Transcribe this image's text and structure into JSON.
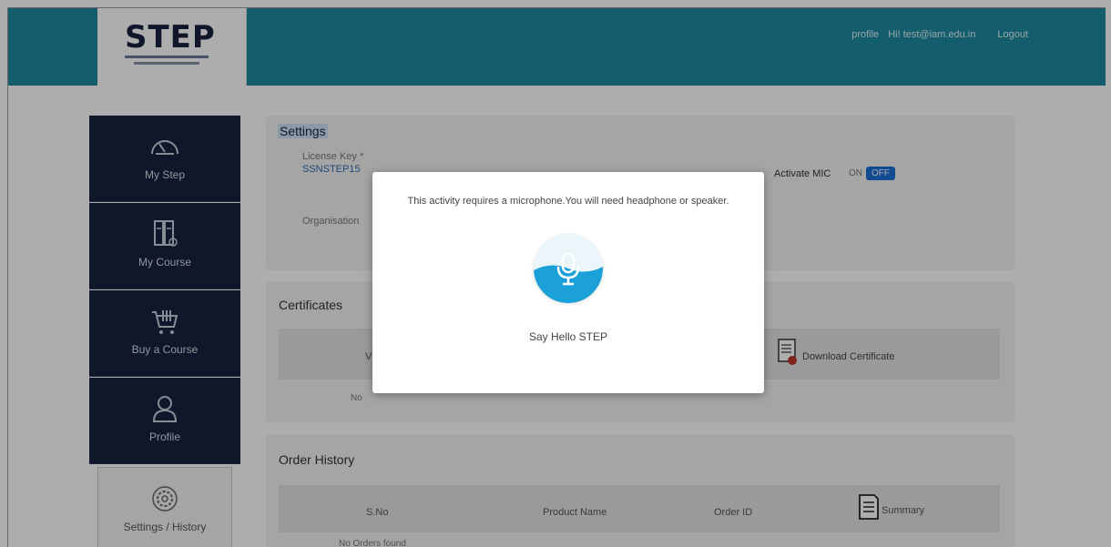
{
  "brand": {
    "logo_text": "STEP"
  },
  "topnav": {
    "profile": "profile",
    "greeting": "Hi! test@iam.edu.in",
    "logout": "Logout"
  },
  "sidebar": {
    "items": [
      {
        "label": "My Step",
        "icon": "dashboard-gauge-icon"
      },
      {
        "label": "My Course",
        "icon": "course-books-icon"
      },
      {
        "label": "Buy a Course",
        "icon": "shopping-cart-icon"
      },
      {
        "label": "Profile",
        "icon": "user-icon"
      },
      {
        "label": "Settings / History",
        "icon": "settings-gear-icon"
      }
    ]
  },
  "settings": {
    "title": "Settings",
    "license_label": "License Key *",
    "license_value": "SSNSTEP15",
    "organisation_label": "Organisation",
    "mic_label": "Activate MIC",
    "mic_on": "ON",
    "mic_off": "OFF"
  },
  "certificates": {
    "title": "Certificates",
    "col_partial": "V",
    "download_label": "Download Certificate",
    "empty_text": "No"
  },
  "orders": {
    "title": "Order History",
    "columns": [
      "S.No",
      "Product Name",
      "Order ID",
      "Summary"
    ],
    "empty_text": "No Orders found"
  },
  "modal": {
    "message": "This activity requires a microphone.You will need headphone or speaker.",
    "caption": "Say Hello STEP"
  },
  "colors": {
    "topbar": "#1e8a9f",
    "sidebar": "#1a2340",
    "toggle_off": "#1a6fd6",
    "mic_wave": "#1ba0d8"
  }
}
